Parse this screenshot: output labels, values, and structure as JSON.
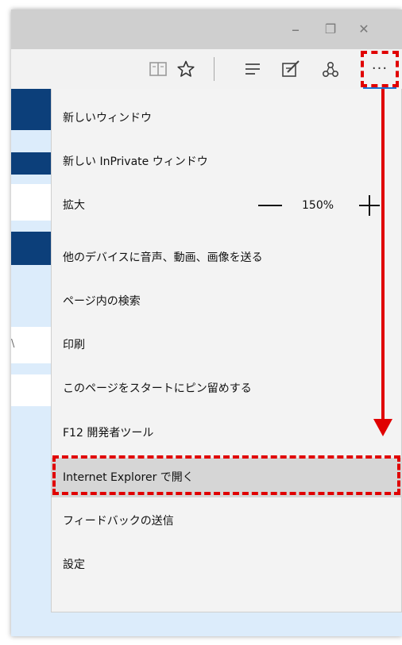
{
  "window": {
    "controls": {
      "minimize": "–",
      "restore": "❐",
      "close": "✕"
    }
  },
  "toolbar": {
    "reading_view_icon": "reading-view-icon",
    "favorites_icon": "star-icon",
    "hub_icon": "hub-icon",
    "web_note_icon": "web-note-icon",
    "share_icon": "share-icon",
    "more_label": "···"
  },
  "page": {
    "card_text": "\\"
  },
  "menu": {
    "items": [
      {
        "label": "新しいウィンドウ"
      },
      {
        "label": "新しい InPrivate ウィンドウ"
      },
      {
        "label": "拡大"
      },
      {
        "label": "他のデバイスに音声、動画、画像を送る"
      },
      {
        "label": "ページ内の検索"
      },
      {
        "label": "印刷"
      },
      {
        "label": "このページをスタートにピン留めする"
      },
      {
        "label": "F12 開発者ツール"
      },
      {
        "label": "Internet Explorer で開く"
      },
      {
        "label": "フィードバックの送信"
      },
      {
        "label": "設定"
      }
    ],
    "zoom": {
      "value": "150%",
      "minus": "—",
      "plus": "+"
    }
  },
  "annotation": {
    "color": "#e00000"
  }
}
